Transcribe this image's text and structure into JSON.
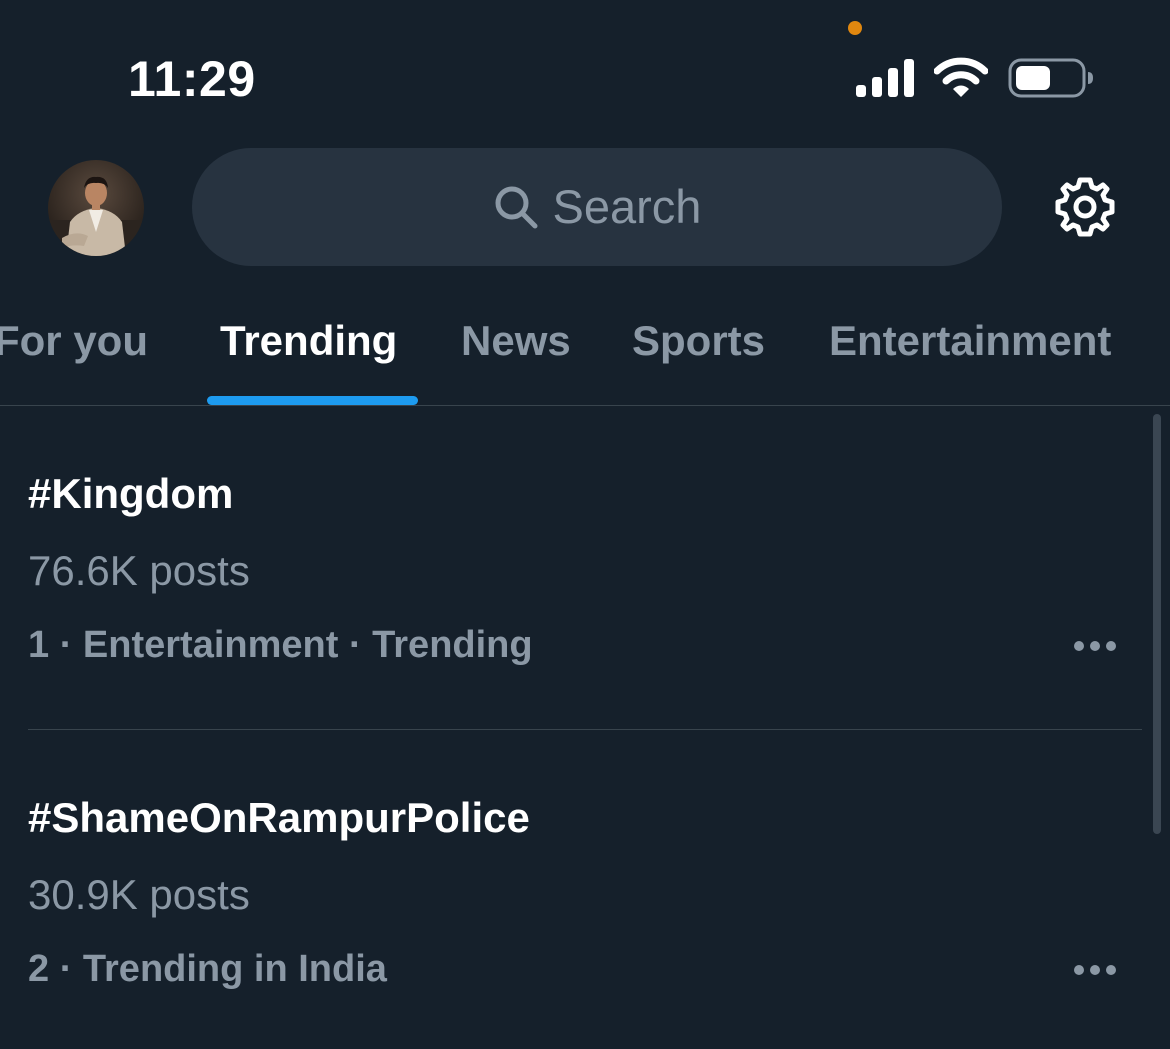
{
  "status_bar": {
    "time": "11:29",
    "icons": [
      "signal-icon",
      "wifi-icon",
      "battery-icon"
    ],
    "battery_level": 0.55,
    "mic_indicator_color": "#e0870f"
  },
  "header": {
    "avatar": "profile-avatar",
    "search": {
      "placeholder": "Search",
      "icon": "search-icon"
    },
    "settings_icon": "gear-icon"
  },
  "tabs": [
    {
      "label": "For you",
      "active": false
    },
    {
      "label": "Trending",
      "active": true
    },
    {
      "label": "News",
      "active": false
    },
    {
      "label": "Sports",
      "active": false
    },
    {
      "label": "Entertainment",
      "active": false
    }
  ],
  "trends": [
    {
      "name": "#Kingdom",
      "posts": "76.6K posts",
      "meta": "1 · Entertainment · Trending",
      "more_icon": "more-horizontal-icon"
    },
    {
      "name": "#ShameOnRampurPolice",
      "posts": "30.9K posts",
      "meta": "2 · Trending in India",
      "more_icon": "more-horizontal-icon"
    }
  ],
  "colors": {
    "background": "#15202b",
    "search_background": "#273340",
    "secondary_text": "#8b98a5",
    "accent": "#1d9bf0",
    "divider": "#38444d"
  }
}
